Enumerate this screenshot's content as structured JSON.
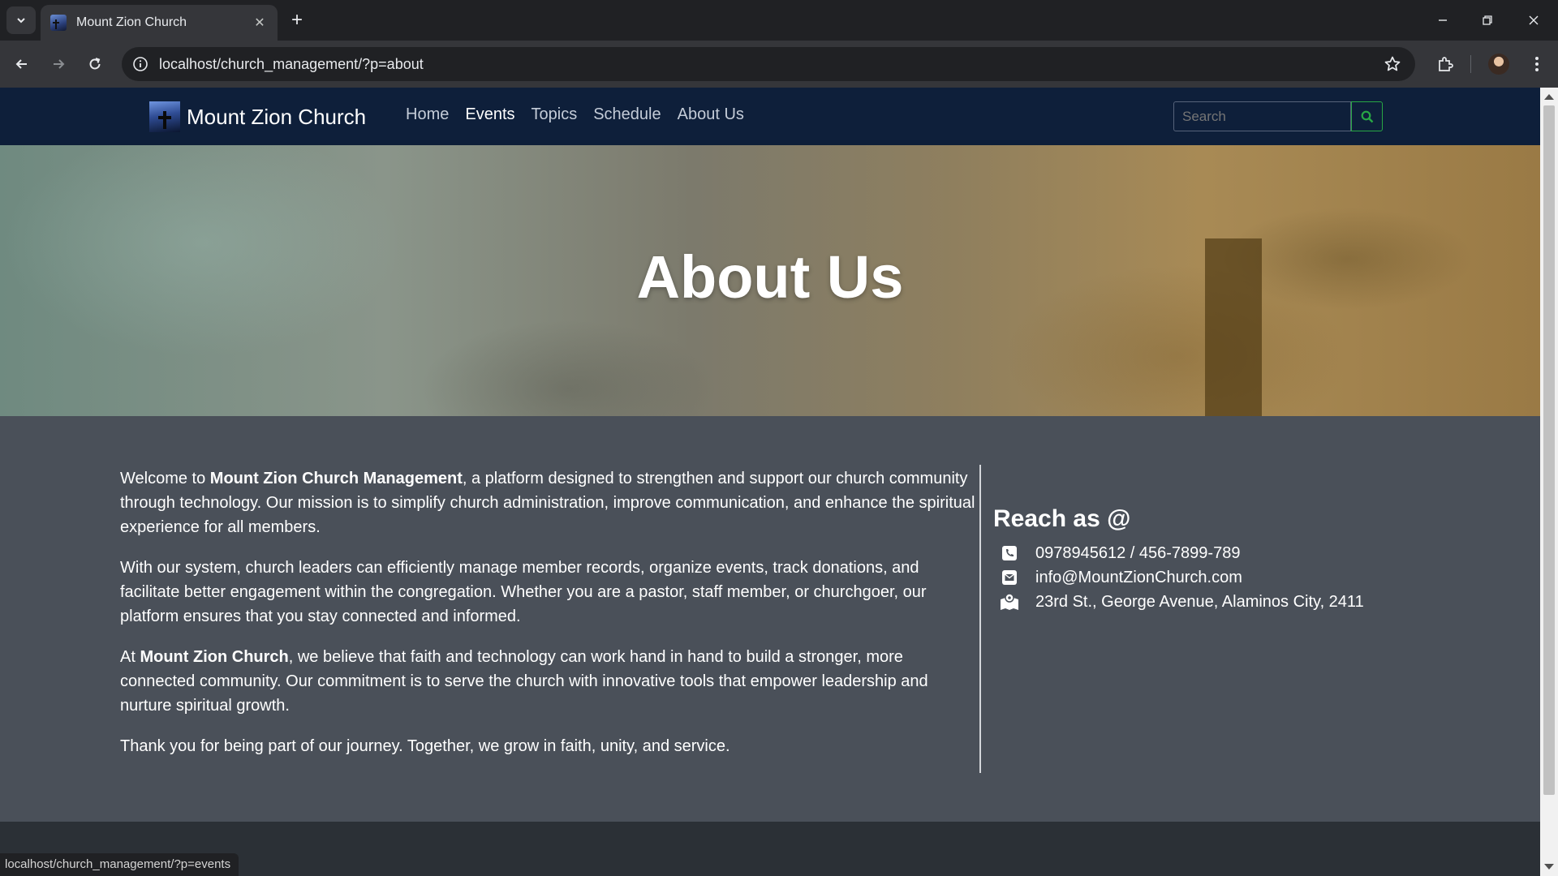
{
  "browser": {
    "tab_title": "Mount Zion Church",
    "url": "localhost/church_management/?p=about",
    "status_url": "localhost/church_management/?p=events"
  },
  "site": {
    "brand": "Mount Zion Church",
    "nav": [
      {
        "label": "Home",
        "active": false
      },
      {
        "label": "Events",
        "active": true
      },
      {
        "label": "Topics",
        "active": false
      },
      {
        "label": "Schedule",
        "active": false
      },
      {
        "label": "About Us",
        "active": false
      }
    ],
    "search_placeholder": "Search"
  },
  "hero": {
    "title": "About Us"
  },
  "about": {
    "p1_pre": "Welcome to ",
    "p1_bold": "Mount Zion Church Management",
    "p1_post": ", a platform designed to strengthen and support our church community through technology. Our mission is to simplify church administration, improve communication, and enhance the spiritual experience for all members.",
    "p2": "With our system, church leaders can efficiently manage member records, organize events, track donations, and facilitate better engagement within the congregation. Whether you are a pastor, staff member, or churchgoer, our platform ensures that you stay connected and informed.",
    "p3_pre": "At ",
    "p3_bold": "Mount Zion Church",
    "p3_post": ", we believe that faith and technology can work hand in hand to build a stronger, more connected community. Our commitment is to serve the church with innovative tools that empower leadership and nurture spiritual growth.",
    "p4": "Thank you for being part of our journey. Together, we grow in faith, unity, and service."
  },
  "contact": {
    "title": "Reach as @",
    "phone": "0978945612 / 456-7899-789",
    "email": "info@MountZionChurch.com",
    "address": "23rd St., George Avenue, Alaminos City, 2411"
  },
  "colors": {
    "navbar": "#0e1f3a",
    "content_bg": "#4a5059",
    "search_accent": "#28a745"
  }
}
